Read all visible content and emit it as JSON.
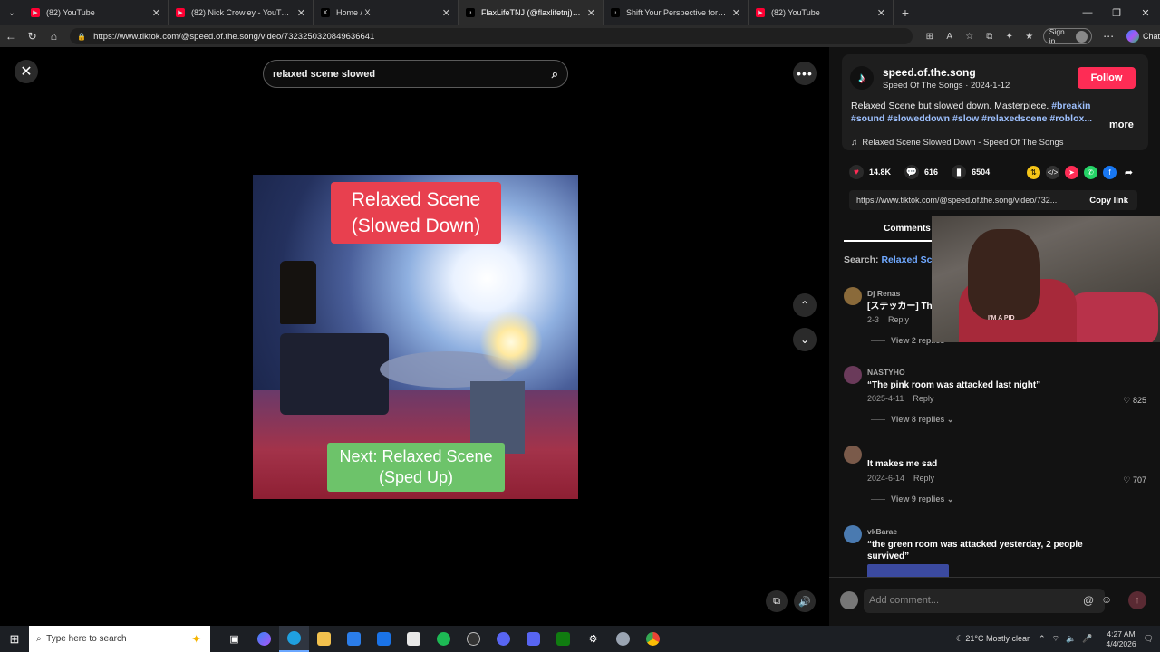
{
  "browser": {
    "tabs": [
      {
        "title": "(82) YouTube",
        "favicon": "youtube-icon",
        "color": "#ff0033"
      },
      {
        "title": "(82) Nick Crowley - YouTube",
        "favicon": "youtube-icon",
        "color": "#ff0033"
      },
      {
        "title": "Home / X",
        "favicon": "x-icon",
        "color": "#000000"
      },
      {
        "title": "FlaxLifeTNJ (@flaxlifetnj) | TikTok",
        "favicon": "tiktok-icon",
        "color": "#000000",
        "active": true
      },
      {
        "title": "Shift Your Perspective for a Better",
        "favicon": "tiktok-icon",
        "color": "#000000"
      },
      {
        "title": "(82) YouTube",
        "favicon": "youtube-icon",
        "color": "#ff0033"
      }
    ],
    "url": "https://www.tiktok.com/@speed.of.the.song/video/7323250320849636641",
    "signin_label": "Sign in",
    "chat_label": "Chat"
  },
  "viewer": {
    "search_query": "relaxed scene slowed",
    "caption_top": "Relaxed Scene\n(Slowed Down)",
    "caption_bottom": "Next: Relaxed Scene\n(Sped Up)"
  },
  "post": {
    "username": "speed.of.the.song",
    "display_name_date": "Speed Of The Songs · 2024-1-12",
    "follow_label": "Follow",
    "description": "Relaxed Scene but slowed down. Masterpiece. ",
    "hashtags": "#breakin #sound #sloweddown #slow #relaxedscene #roblox...",
    "more_label": "more",
    "music": "Relaxed Scene Slowed Down - Speed Of The Songs",
    "likes": "14.8K",
    "comments": "616",
    "saves": "6504",
    "share_link": "https://www.tiktok.com/@speed.of.the.song/video/732...",
    "copy_label": "Copy link",
    "accent": "#fe2c55"
  },
  "comments_panel": {
    "tab_label": "Comments",
    "search_prefix": "Search: ",
    "search_query": "Relaxed Sc",
    "items": [
      {
        "user": "Dj Renas",
        "text": "[ステッカー] Th",
        "date": "2-3",
        "reply": "Reply",
        "likes": "",
        "replies": "View 2 replies"
      },
      {
        "user": "NASTYHO",
        "text": "“The pink room was attacked last night”",
        "date": "2025-4-11",
        "reply": "Reply",
        "likes": "825",
        "replies": "View 8 replies ⌄"
      },
      {
        "user": "",
        "text": "It makes me sad",
        "date": "2024-6-14",
        "reply": "Reply",
        "likes": "707",
        "replies": "View 9 replies ⌄"
      },
      {
        "user": "vkBarae",
        "text": "“the green room was attacked yesterday, 2 people survived”",
        "date": "",
        "reply": "",
        "likes": "",
        "replies": ""
      }
    ],
    "add_placeholder": "Add comment...",
    "webcam_text": "I'M A PID"
  },
  "taskbar": {
    "search_placeholder": "Type here to search",
    "weather": "21°C  Mostly clear",
    "time": "4:27 AM",
    "date": "4/4/2026"
  }
}
